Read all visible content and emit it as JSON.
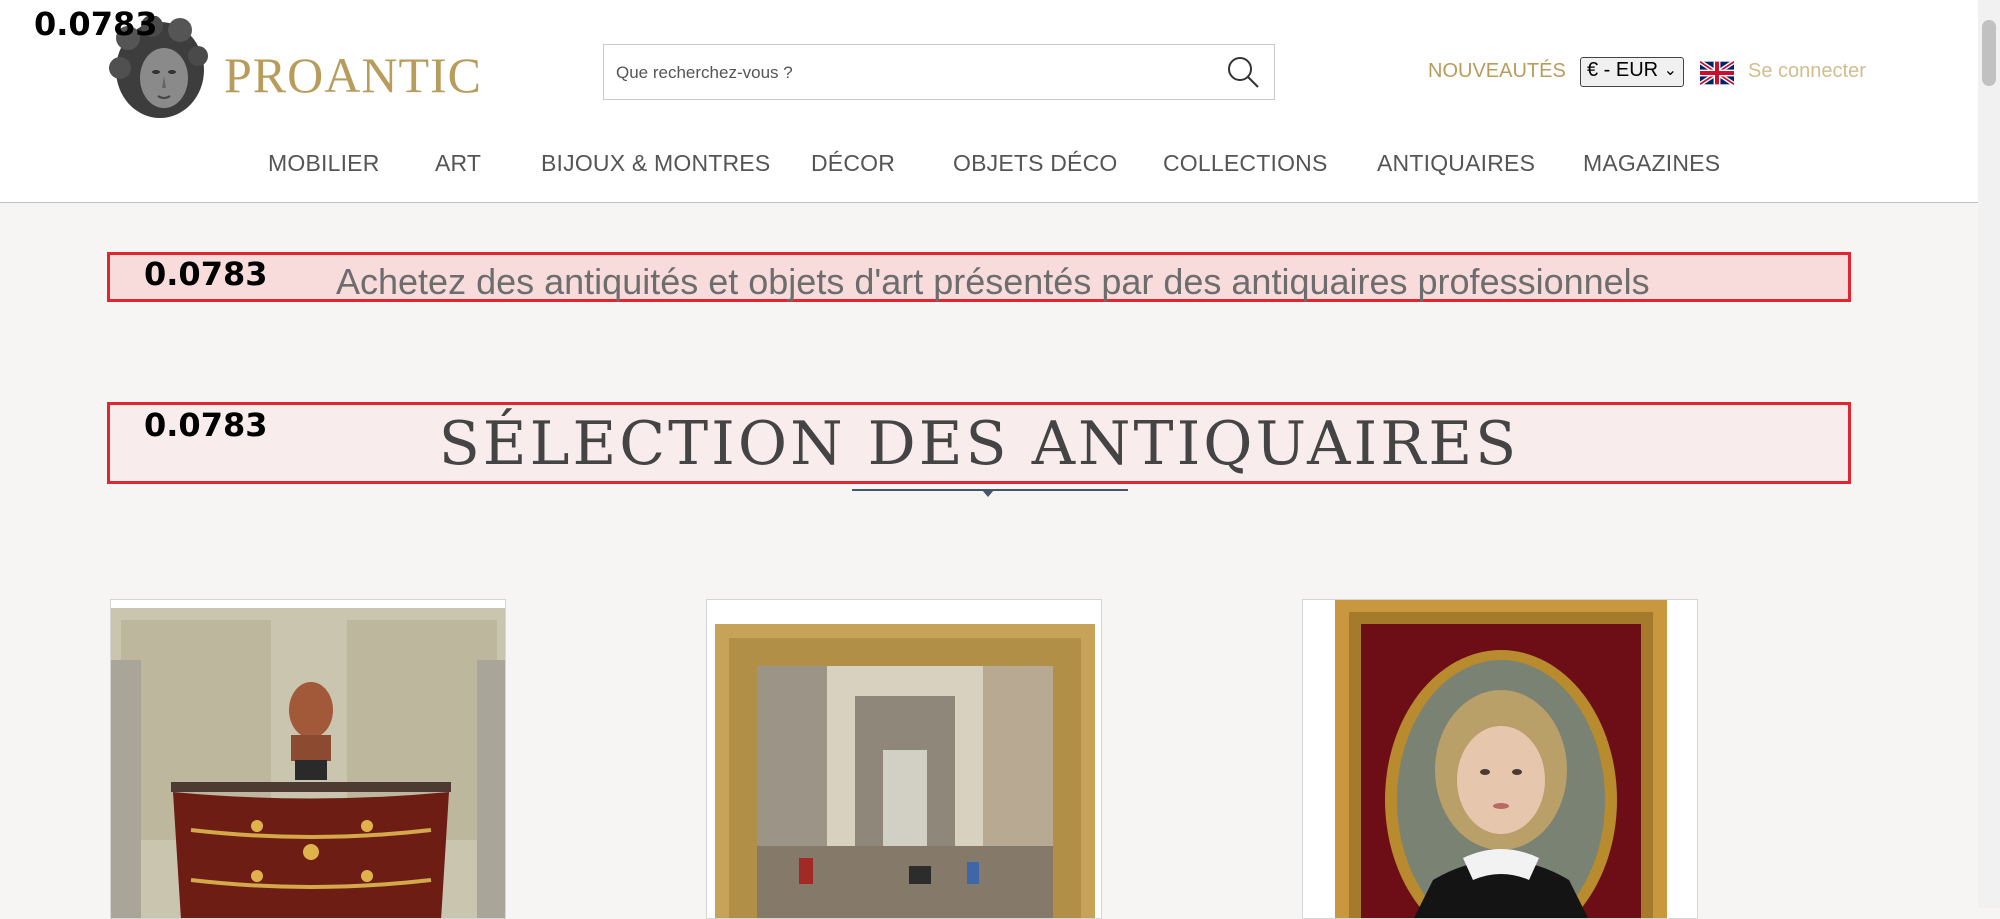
{
  "overlay": {
    "score_top": "0.0783",
    "score_banner": "0.0783",
    "score_title": "0.0783"
  },
  "header": {
    "brand": "PROANTIC",
    "search_placeholder": "Que recherchez-vous ?",
    "nouveautes": "NOUVEAUTÉS",
    "currency": "€ - EUR",
    "login": "Se connecter"
  },
  "nav": {
    "items": [
      "MOBILIER",
      "ART",
      "BIJOUX & MONTRES",
      "DÉCOR",
      "OBJETS DÉCO",
      "COLLECTIONS",
      "ANTIQUAIRES",
      "MAGAZINES"
    ]
  },
  "banner": {
    "text": "Achetez des antiquités et objets d'art présentés par des antiquaires professionnels"
  },
  "section": {
    "title": "SÉLECTION DES ANTIQUAIRES"
  },
  "colors": {
    "brand_gold": "#b89c5c",
    "highlight_red": "#e0262e",
    "underline_blue": "#46566a"
  }
}
